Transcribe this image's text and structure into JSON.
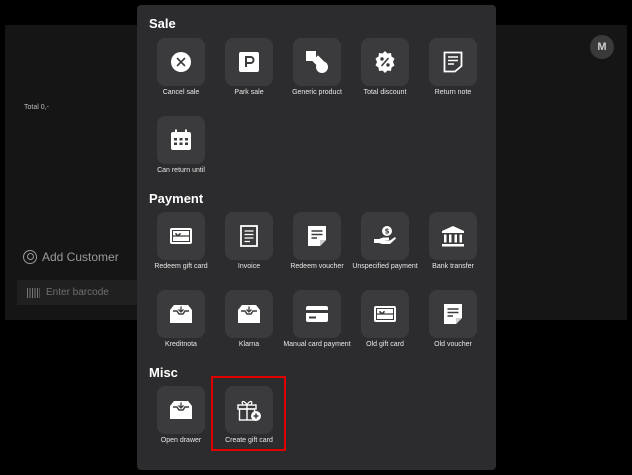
{
  "background": {
    "avatar_letter": "M",
    "total_text": "Total 0,-",
    "add_customer_label": "Add Customer",
    "barcode_placeholder": "Enter barcode"
  },
  "modal": {
    "sections": {
      "sale": {
        "title": "Sale",
        "items": [
          {
            "label": "Cancel sale",
            "icon": "cancel-icon"
          },
          {
            "label": "Park sale",
            "icon": "parking-icon"
          },
          {
            "label": "Generic product",
            "icon": "shapes-icon"
          },
          {
            "label": "Total discount",
            "icon": "percent-badge-icon"
          },
          {
            "label": "Return note",
            "icon": "note-icon"
          },
          {
            "label": "Can return until",
            "icon": "calendar-icon"
          }
        ]
      },
      "payment": {
        "title": "Payment",
        "items": [
          {
            "label": "Redeem gift card",
            "icon": "gift-card-icon"
          },
          {
            "label": "Invoice",
            "icon": "invoice-icon"
          },
          {
            "label": "Redeem voucher",
            "icon": "voucher-icon"
          },
          {
            "label": "Unspecified payment",
            "icon": "hand-coin-icon"
          },
          {
            "label": "Bank transfer",
            "icon": "bank-icon"
          },
          {
            "label": "Kreditnota",
            "icon": "tray-icon"
          },
          {
            "label": "Klarna",
            "icon": "tray-icon"
          },
          {
            "label": "Manual card payment",
            "icon": "credit-card-icon"
          },
          {
            "label": "Old gift card",
            "icon": "gift-card-icon"
          },
          {
            "label": "Old voucher",
            "icon": "voucher-icon"
          }
        ]
      },
      "misc": {
        "title": "Misc",
        "items": [
          {
            "label": "Open drawer",
            "icon": "drawer-icon"
          },
          {
            "label": "Create gift card",
            "icon": "gift-plus-icon"
          }
        ]
      }
    },
    "highlight_color": "#e00000"
  }
}
